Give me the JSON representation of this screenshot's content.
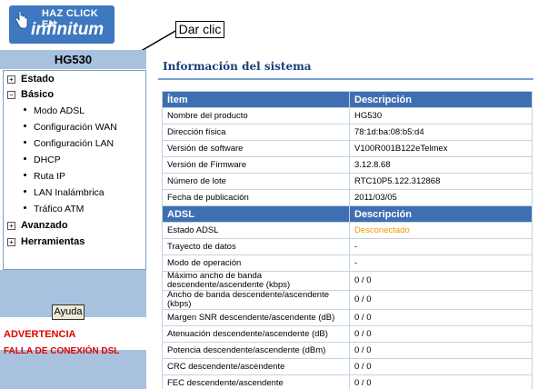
{
  "header": {
    "logo_top": "HAZ CLICK EN",
    "logo_main": "infinitum",
    "callout": "Dar clic"
  },
  "sidebar": {
    "title": "HG530",
    "items": [
      {
        "label": "Estado",
        "toggle": "+"
      },
      {
        "label": "Básico",
        "toggle": "−"
      },
      {
        "label": "Avanzado",
        "toggle": "+"
      },
      {
        "label": "Herramientas",
        "toggle": "+"
      }
    ],
    "sub_items": [
      "Modo ADSL",
      "Configuración WAN",
      "Configuración LAN",
      "DHCP",
      "Ruta IP",
      "LAN Inalámbrica",
      "Tráfico ATM"
    ],
    "help_button": "Ayuda",
    "warning_title": "ADVERTENCIA",
    "warning_text": "FALLA DE CONEXIÓN DSL"
  },
  "main": {
    "title": "Información del sistema",
    "headers": {
      "item": "Ítem",
      "description": "Descripción"
    },
    "rows": [
      {
        "label": "Nombre del producto",
        "value": "HG530"
      },
      {
        "label": "Dirección física",
        "value": "78:1d:ba:08:b5:d4"
      },
      {
        "label": "Versión de software",
        "value": "V100R001B122eTelmex"
      },
      {
        "label": "Versión de Firmware",
        "value": "3.12.8.68"
      },
      {
        "label": "Número de lote",
        "value": "RTC10P5.122.312868"
      },
      {
        "label": "Fecha de publicación",
        "value": "2011/03/05"
      }
    ],
    "adsl_headers": {
      "item": "ADSL",
      "description": "Descripción"
    },
    "adsl_rows": [
      {
        "label": "Estado ADSL",
        "value": "Desconectado"
      },
      {
        "label": "Trayecto de datos",
        "value": "-"
      },
      {
        "label": "Modo de operación",
        "value": "-"
      },
      {
        "label": "Máximo ancho de banda descendente/ascendente (kbps)",
        "value": "0 / 0"
      },
      {
        "label": "Ancho de banda descendente/ascendente (kbps)",
        "value": "0 / 0"
      },
      {
        "label": "Margen SNR descendente/ascendente (dB)",
        "value": "0 / 0"
      },
      {
        "label": "Atenuación descendente/ascendente (dB)",
        "value": "0 / 0"
      },
      {
        "label": "Potencia descendente/ascendente (dBm)",
        "value": "0 / 0"
      },
      {
        "label": "CRC descendente/ascendente",
        "value": "0 / 0"
      },
      {
        "label": "FEC  descendente/ascendente",
        "value": "0 / 0"
      }
    ],
    "status_color": "#f29600"
  }
}
